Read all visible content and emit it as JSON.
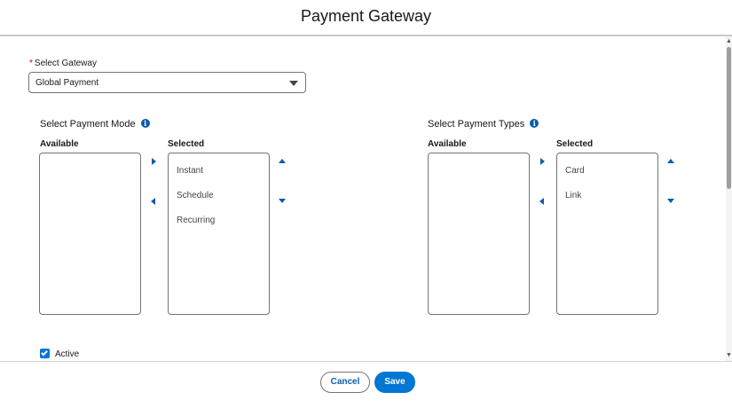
{
  "modal": {
    "title": "Payment Gateway"
  },
  "gateway": {
    "required_mark": "*",
    "label": "Select Gateway",
    "selected": "Global Payment"
  },
  "payment_mode": {
    "title": "Select Payment Mode",
    "available_label": "Available",
    "selected_label": "Selected",
    "available_items": [],
    "selected_items": [
      "Instant",
      "Schedule",
      "Recurring"
    ]
  },
  "payment_types": {
    "title": "Select Payment Types",
    "available_label": "Available",
    "selected_label": "Selected",
    "available_items": [],
    "selected_items": [
      "Card",
      "Link"
    ]
  },
  "active": {
    "label": "Active",
    "checked": true
  },
  "footer": {
    "cancel_label": "Cancel",
    "save_label": "Save"
  },
  "colors": {
    "brand": "#0176d3",
    "brand_dark": "#0b5cab",
    "required": "#ba0517",
    "border": "#747474"
  },
  "icons": {
    "info": "info-icon",
    "dropdown": "chevron-down-icon",
    "move_right": "arrow-right-icon",
    "move_left": "arrow-left-icon",
    "move_up": "arrow-up-icon",
    "move_down": "arrow-down-icon",
    "checkbox": "checkmark-icon"
  }
}
